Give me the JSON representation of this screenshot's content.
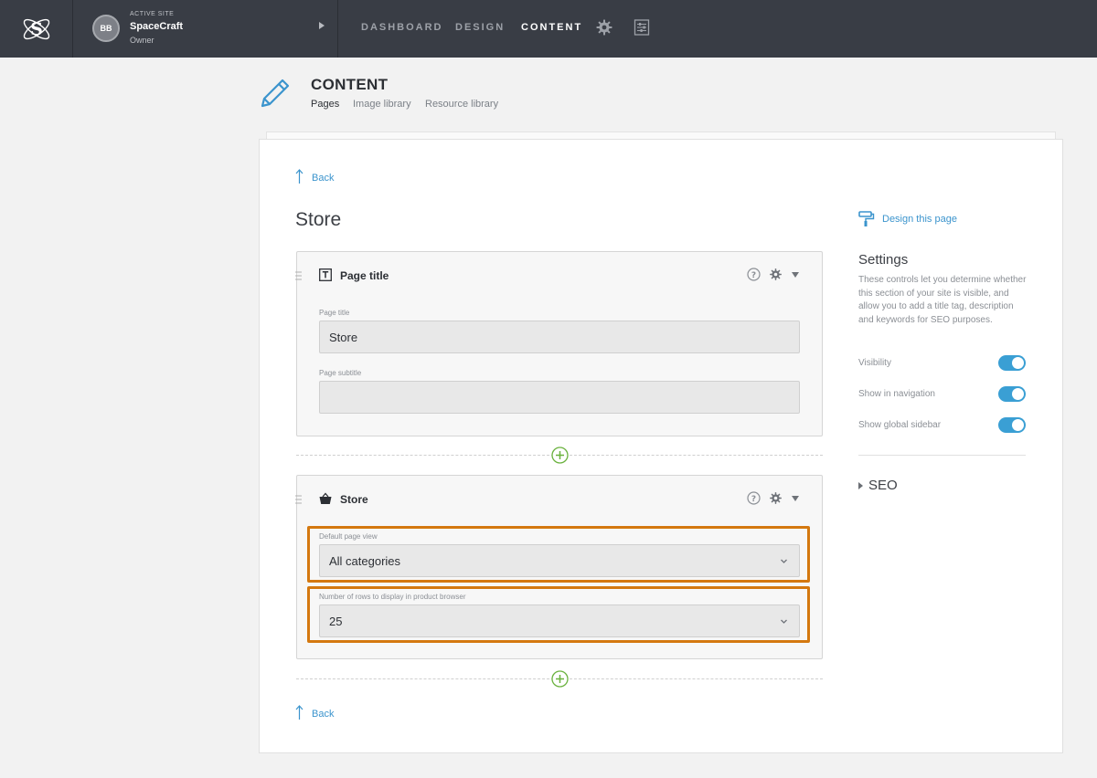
{
  "topbar": {
    "logo_letter": "S",
    "avatar_initials": "BB",
    "active_site_label": "ACTIVE SITE",
    "site_name": "SpaceCraft",
    "role": "Owner",
    "nav": [
      {
        "label": "DASHBOARD",
        "active": false
      },
      {
        "label": "DESIGN",
        "active": false
      },
      {
        "label": "CONTENT",
        "active": true
      }
    ],
    "icons": [
      "gear-icon",
      "sliders-icon"
    ]
  },
  "header": {
    "title": "CONTENT",
    "tabs": [
      {
        "label": "Pages",
        "active": true
      },
      {
        "label": "Image library",
        "active": false
      },
      {
        "label": "Resource library",
        "active": false
      }
    ]
  },
  "main": {
    "back_label": "Back",
    "page_heading": "Store",
    "blocks": [
      {
        "title": "Page title",
        "icon": "text-t-icon",
        "fields": [
          {
            "label": "Page title",
            "value": "Store"
          },
          {
            "label": "Page subtitle",
            "value": ""
          }
        ]
      },
      {
        "title": "Store",
        "icon": "shopping-basket-icon",
        "fields": [
          {
            "label": "Default page view",
            "value": "All categories"
          },
          {
            "label": "Number of rows to display in product browser",
            "value": "25"
          }
        ]
      }
    ],
    "highlight_color": "#d4780f"
  },
  "sidebar": {
    "design_link": "Design this page",
    "settings_title": "Settings",
    "settings_desc": "These controls let you determine whether this section of your site is visible, and allow you to add a title tag, description and keywords for SEO purposes.",
    "toggles": [
      {
        "label": "Visibility",
        "on": true
      },
      {
        "label": "Show in navigation",
        "on": true
      },
      {
        "label": "Show global sidebar",
        "on": true
      }
    ],
    "seo_label": "SEO"
  },
  "colors": {
    "topbar": "#393d45",
    "accent": "#3b94cd",
    "toggle_on": "#3a9fd4",
    "add_green": "#6ab23e"
  }
}
